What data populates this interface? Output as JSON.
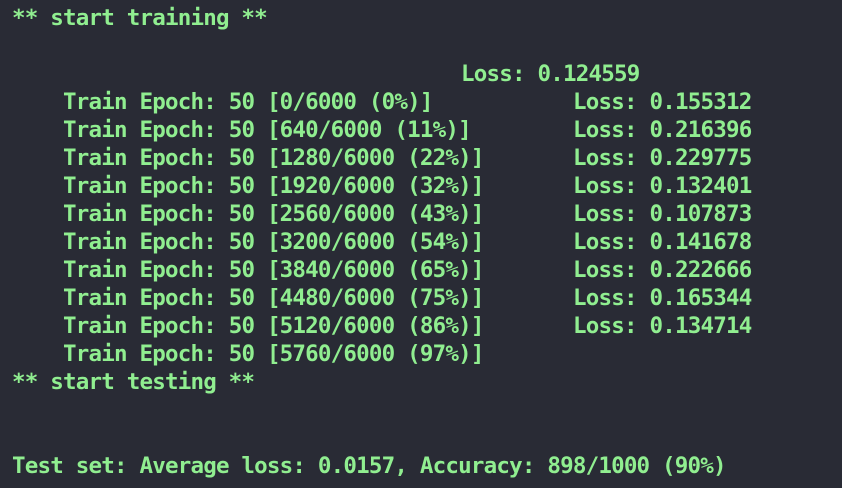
{
  "training_header": "** start training **",
  "train_lines": [
    {
      "progress": "Train Epoch: 50 [0/6000 (0%)]",
      "loss": "Loss: 0.124559"
    },
    {
      "progress": "Train Epoch: 50 [640/6000 (11%)]",
      "loss": "Loss: 0.155312"
    },
    {
      "progress": "Train Epoch: 50 [1280/6000 (22%)]",
      "loss": "Loss: 0.216396"
    },
    {
      "progress": "Train Epoch: 50 [1920/6000 (32%)]",
      "loss": "Loss: 0.229775"
    },
    {
      "progress": "Train Epoch: 50 [2560/6000 (43%)]",
      "loss": "Loss: 0.132401"
    },
    {
      "progress": "Train Epoch: 50 [3200/6000 (54%)]",
      "loss": "Loss: 0.107873"
    },
    {
      "progress": "Train Epoch: 50 [3840/6000 (65%)]",
      "loss": "Loss: 0.141678"
    },
    {
      "progress": "Train Epoch: 50 [4480/6000 (75%)]",
      "loss": "Loss: 0.222666"
    },
    {
      "progress": "Train Epoch: 50 [5120/6000 (86%)]",
      "loss": "Loss: 0.165344"
    },
    {
      "progress": "Train Epoch: 50 [5760/6000 (97%)]",
      "loss": "Loss: 0.134714"
    }
  ],
  "testing_header": "** start testing **",
  "test_result": "Test set: Average loss: 0.0157, Accuracy: 898/1000 (90%)",
  "colors": {
    "background": "#292b35",
    "text": "#90ee90"
  }
}
